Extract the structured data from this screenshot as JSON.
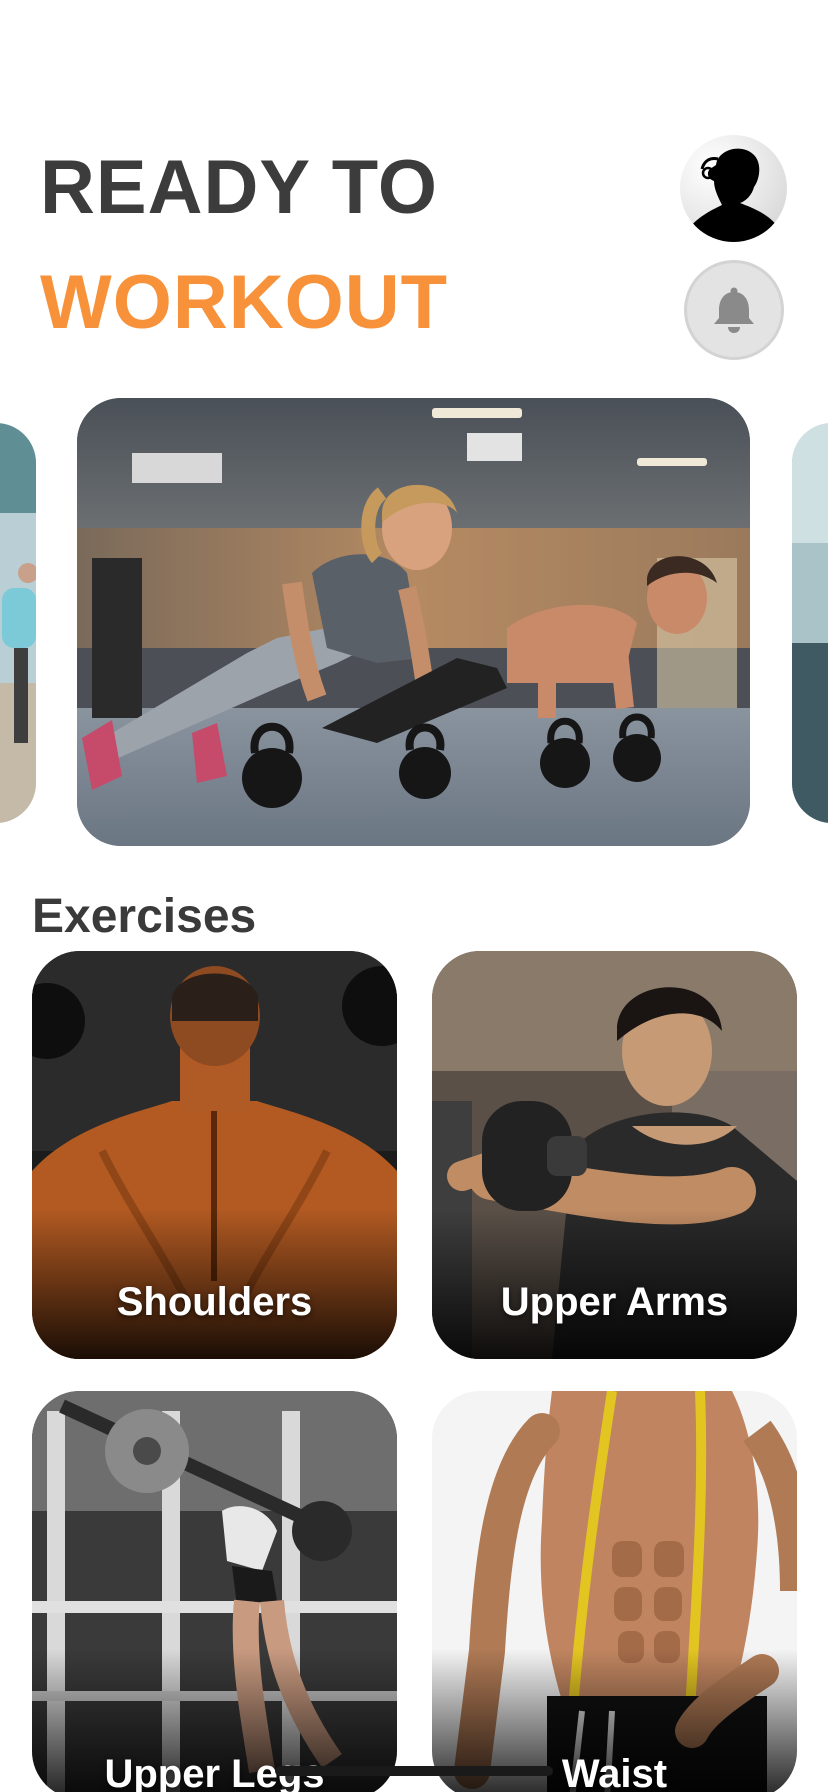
{
  "header": {
    "line1": "READY TO",
    "line2": "WORKOUT",
    "accent_color": "#f7923a",
    "text_color": "#3c3c3c"
  },
  "actions": {
    "profile_icon": "user-avatar",
    "notification_icon": "bell-icon"
  },
  "carousel": {
    "slides": [
      {
        "image": "woman-running-outdoors"
      },
      {
        "image": "kettlebell-pushups-gym"
      },
      {
        "image": "gym-interior"
      }
    ],
    "active_index": 1
  },
  "exercises": {
    "title": "Exercises",
    "cards": [
      {
        "label": "Shoulders"
      },
      {
        "label": "Upper Arms"
      },
      {
        "label": "Upper Legs"
      },
      {
        "label": "Waist"
      }
    ]
  }
}
